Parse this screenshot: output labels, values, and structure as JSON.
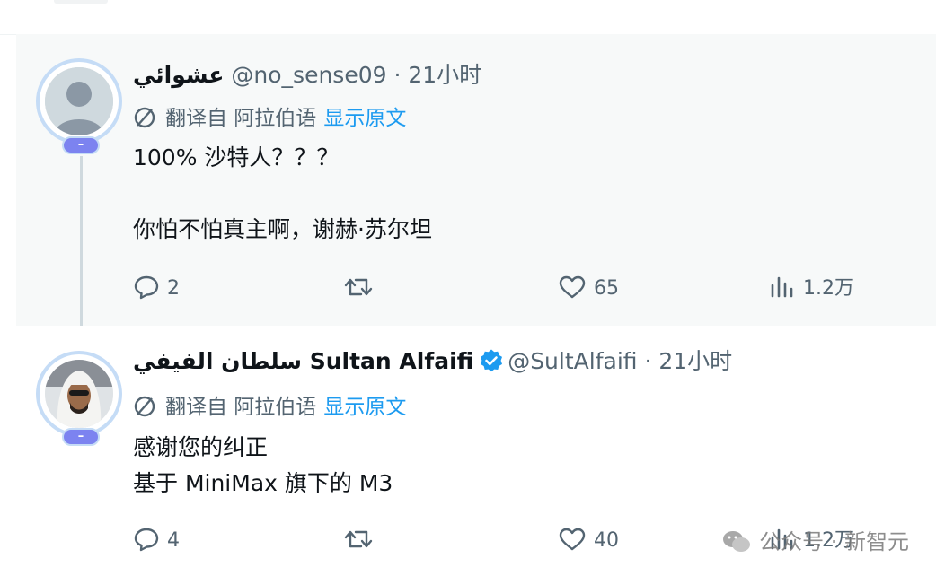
{
  "tweets": [
    {
      "display_name": "عشوائي",
      "handle": "@no_sense09",
      "separator": "·",
      "time": "21小时",
      "translate": {
        "label": "翻译自 阿拉伯语",
        "show_original": "显示原文"
      },
      "badge": "–",
      "body": [
        "100% 沙特人？？？",
        "你怕不怕真主啊，谢赫·苏尔坦"
      ],
      "stats": {
        "replies": "2",
        "retweets": "",
        "likes": "65",
        "views": "1.2万"
      }
    },
    {
      "display_name": "سلطان الفيفي Sultan Alfaifi",
      "handle": "@SultAlfaifi",
      "separator": "·",
      "time": "21小时",
      "translate": {
        "label": "翻译自 阿拉伯语",
        "show_original": "显示原文"
      },
      "badge": "–",
      "body": [
        "感谢您的纠正",
        "基于 MiniMax 旗下的 M3"
      ],
      "stats": {
        "replies": "4",
        "retweets": "",
        "likes": "40",
        "views": "1.2万"
      }
    }
  ],
  "watermark": "公众号 · 新智元",
  "colors": {
    "accent": "#1d9bf0",
    "muted": "#536471",
    "badge": "#7c83f0",
    "highlight_bg": "#f7f9f9"
  }
}
